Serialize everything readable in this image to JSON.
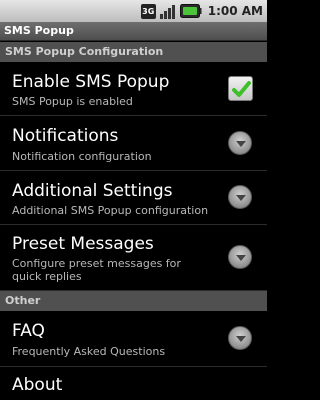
{
  "status_bar": {
    "network": "3G",
    "clock": "1:00 AM"
  },
  "app_title": "SMS Popup",
  "sections": [
    {
      "header": "SMS Popup Configuration",
      "items": [
        {
          "title": "Enable SMS Popup",
          "summary": "SMS Popup is enabled",
          "widget": "checkbox",
          "checked": true
        },
        {
          "title": "Notifications",
          "summary": "Notification configuration",
          "widget": "chevron"
        },
        {
          "title": "Additional Settings",
          "summary": "Additional SMS Popup configuration",
          "widget": "chevron"
        },
        {
          "title": "Preset Messages",
          "summary": "Configure preset messages for quick replies",
          "widget": "chevron"
        }
      ]
    },
    {
      "header": "Other",
      "items": [
        {
          "title": "FAQ",
          "summary": "Frequently Asked Questions",
          "widget": "chevron"
        },
        {
          "title": "About",
          "summary": "",
          "widget": "none"
        }
      ]
    }
  ],
  "colors": {
    "accent_check": "#3fbf2a",
    "category_bg": "#505050",
    "background": "#000000"
  }
}
